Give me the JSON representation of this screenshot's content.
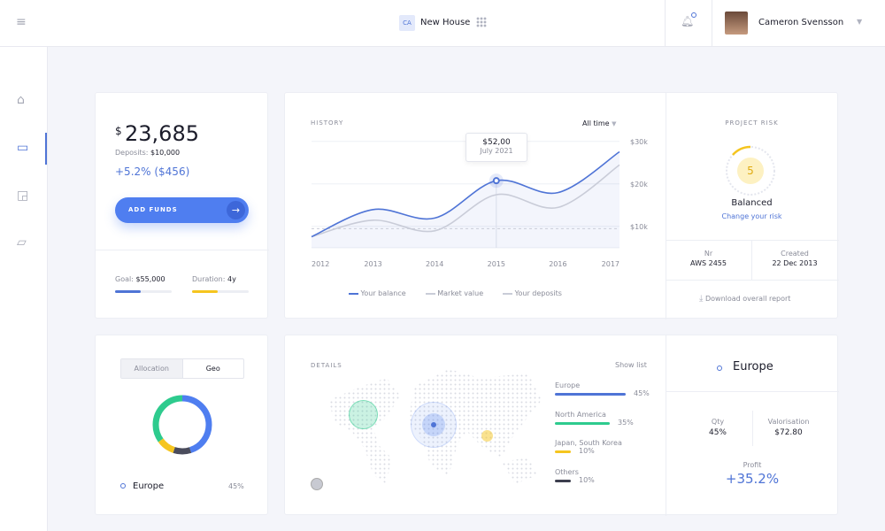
{
  "header": {
    "project_badge": "CA",
    "project_name": "New House",
    "user_name": "Cameron Svensson"
  },
  "sidebar": {
    "items": [
      {
        "name": "home-icon"
      },
      {
        "name": "wallet-icon",
        "active": true
      },
      {
        "name": "export-icon"
      },
      {
        "name": "folder-icon"
      }
    ]
  },
  "balance": {
    "currency": "$",
    "amount": "23,685",
    "deposits_label": "Deposits:",
    "deposits_value": "$10,000",
    "change": "+5.2% ($456)",
    "add_funds_label": "ADD FUNDS",
    "goal_label": "Goal:",
    "goal_value": "$55,000",
    "goal_progress": 0.45,
    "duration_label": "Duration:",
    "duration_value": "4y",
    "duration_progress": 0.45
  },
  "history": {
    "title": "HISTORY",
    "range_select": "All time",
    "tooltip_value": "$52,00",
    "tooltip_date": "July 2021"
  },
  "chart_data": {
    "type": "line",
    "x": [
      "2012",
      "2013",
      "2014",
      "2015",
      "2016",
      "2017"
    ],
    "y_ticks": [
      "$10k",
      "$20k",
      "$30k"
    ],
    "ylim": [
      6,
      31
    ],
    "series": [
      {
        "name": "Your balance",
        "values": [
          8.6,
          15,
          13,
          21.8,
          19,
          28.6
        ],
        "color": "#4f74d6"
      },
      {
        "name": "Market value",
        "values": [
          8.6,
          12.5,
          10,
          18.5,
          15.5,
          25.5
        ],
        "color": "#c9ccd8"
      },
      {
        "name": "Your deposits",
        "values": [
          10.5,
          10.5,
          10.5,
          10.5,
          10.5,
          10.5
        ],
        "color": "#c9ccd8",
        "dashed": true
      }
    ],
    "highlight_x": "2015",
    "grid": true,
    "legend": "bottom"
  },
  "risk": {
    "title": "PROJECT RISK",
    "score": "5",
    "level": "Balanced",
    "change_link": "Change your risk",
    "nr_label": "Nr",
    "nr_value": "AWS 2455",
    "created_label": "Created",
    "created_value": "22 Dec 2013",
    "download_label": "Download overall report"
  },
  "allocation": {
    "tabs": [
      "Allocation",
      "Geo"
    ],
    "active_tab": "Allocation",
    "selected": "Europe",
    "selected_pct": "45%",
    "segments": [
      {
        "name": "Europe",
        "value": 45,
        "color": "#4f7ef0"
      },
      {
        "name": "Others",
        "value": 10,
        "color": "#4a4c5c"
      },
      {
        "name": "Japan, South Korea",
        "value": 10,
        "color": "#f5c51f"
      },
      {
        "name": "North America",
        "value": 35,
        "color": "#2ecb8e"
      }
    ]
  },
  "details": {
    "title": "DETAILS",
    "show_list": "Show list",
    "regions": [
      {
        "name": "Europe",
        "pct": "45%",
        "value": 45,
        "color": "#4f74d6"
      },
      {
        "name": "North America",
        "pct": "35%",
        "value": 35,
        "color": "#2ecb8e"
      },
      {
        "name": "Japan, South Korea",
        "pct": "10%",
        "value": 10,
        "color": "#f5c51f"
      },
      {
        "name": "Others",
        "pct": "10%",
        "value": 10,
        "color": "#3c3e4e"
      }
    ]
  },
  "region_detail": {
    "name": "Europe",
    "qty_label": "Qty",
    "qty_value": "45%",
    "valorisation_label": "Valorisation",
    "valorisation_value": "$72.80",
    "profit_label": "Profit",
    "profit_value": "+35.2%"
  }
}
